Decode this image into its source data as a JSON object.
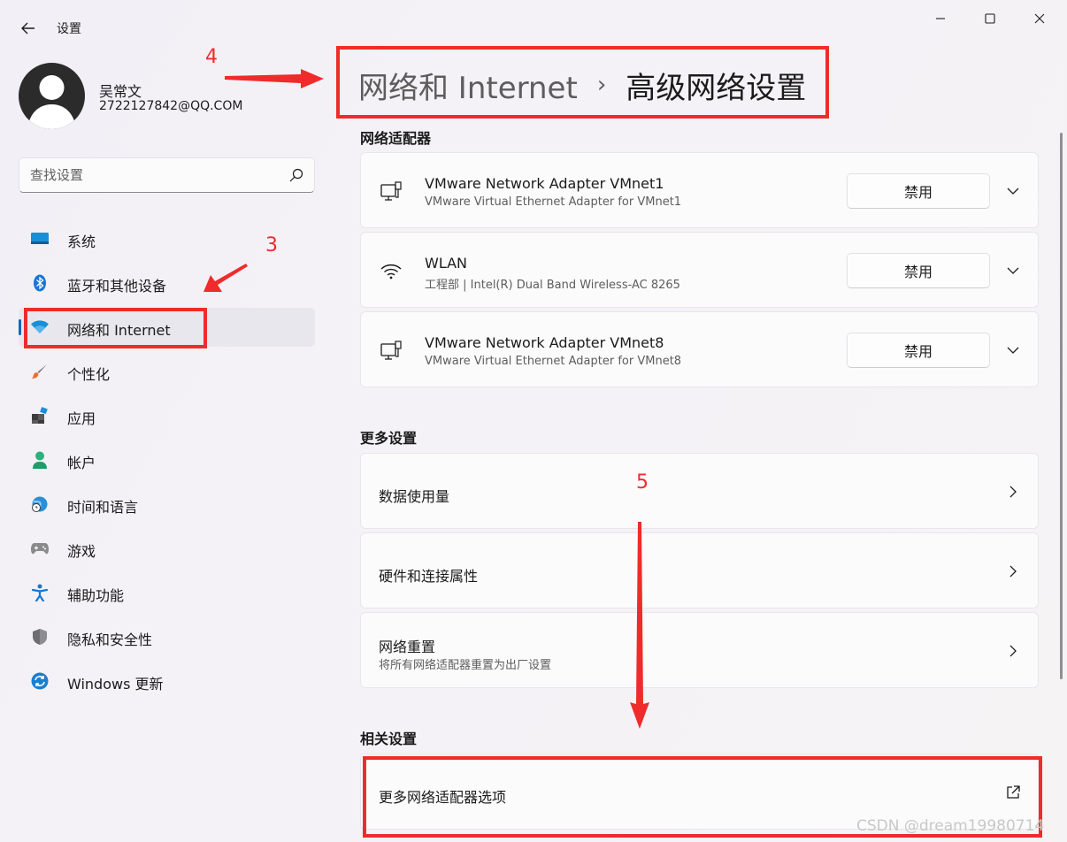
{
  "window": {
    "title": "设置",
    "controls": [
      "minimize-icon",
      "maximize-icon",
      "close-icon"
    ]
  },
  "user": {
    "name": "吴常文",
    "email": "2722127842@QQ.COM"
  },
  "search": {
    "placeholder": "查找设置"
  },
  "sidebar": {
    "items": [
      {
        "label": "系统",
        "icon": "monitor-icon",
        "active": false
      },
      {
        "label": "蓝牙和其他设备",
        "icon": "bluetooth-icon",
        "active": false
      },
      {
        "label": "网络和 Internet",
        "icon": "wifi-icon",
        "active": true
      },
      {
        "label": "个性化",
        "icon": "brush-icon",
        "active": false
      },
      {
        "label": "应用",
        "icon": "apps-icon",
        "active": false
      },
      {
        "label": "帐户",
        "icon": "person-icon",
        "active": false
      },
      {
        "label": "时间和语言",
        "icon": "globe-clock-icon",
        "active": false
      },
      {
        "label": "游戏",
        "icon": "gamepad-icon",
        "active": false
      },
      {
        "label": "辅助功能",
        "icon": "accessibility-icon",
        "active": false
      },
      {
        "label": "隐私和安全性",
        "icon": "shield-icon",
        "active": false
      },
      {
        "label": "Windows 更新",
        "icon": "update-icon",
        "active": false
      }
    ]
  },
  "header": {
    "parent": "网络和 Internet",
    "separator": "›",
    "current": "高级网络设置"
  },
  "sections": {
    "adapters_title": "网络适配器",
    "more_title": "更多设置",
    "related_title": "相关设置"
  },
  "adapters": [
    {
      "name": "VMware Network Adapter VMnet1",
      "desc": "VMware Virtual Ethernet Adapter for VMnet1",
      "button": "禁用",
      "icon": "ethernet-icon"
    },
    {
      "name": "WLAN",
      "desc": "工程部 | Intel(R) Dual Band Wireless-AC 8265",
      "button": "禁用",
      "icon": "wifi-icon"
    },
    {
      "name": "VMware Network Adapter VMnet8",
      "desc": "VMware Virtual Ethernet Adapter for VMnet8",
      "button": "禁用",
      "icon": "ethernet-icon"
    }
  ],
  "more_settings": [
    {
      "label": "数据使用量",
      "sub": ""
    },
    {
      "label": "硬件和连接属性",
      "sub": ""
    },
    {
      "label": "网络重置",
      "sub": "将所有网络适配器重置为出厂设置"
    }
  ],
  "related_settings": [
    {
      "label": "更多网络适配器选项",
      "icon": "external-link-icon"
    }
  ],
  "annotations": {
    "n3": "3",
    "n4": "4",
    "n5": "5",
    "color": "#ef2b2b"
  },
  "watermark": "CSDN @dream19980714",
  "colors": {
    "accent": "#0067c0",
    "annotation": "#ef2b2b"
  }
}
